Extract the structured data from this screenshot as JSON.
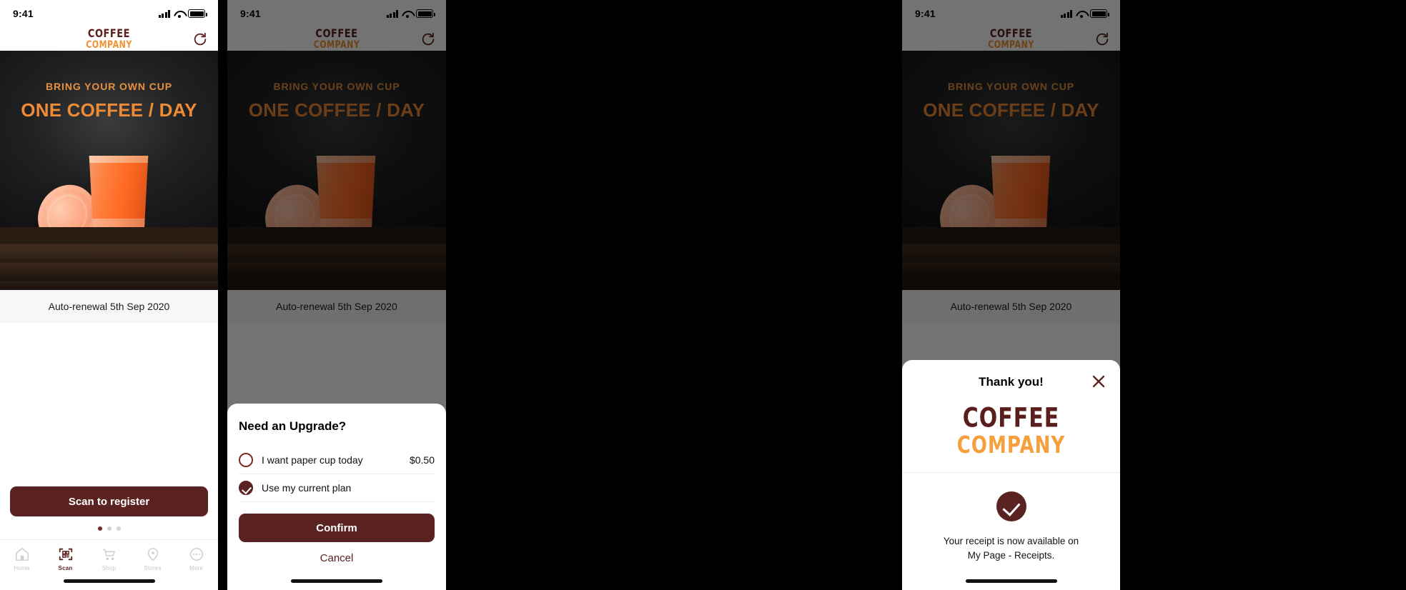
{
  "status_bar": {
    "time": "9:41"
  },
  "brand": {
    "logo_line1": "COFFEE",
    "logo_line2": "COMPANY",
    "primary_color": "#5a2220",
    "accent_color": "#f09433"
  },
  "header": {
    "refresh_icon": "refresh-icon"
  },
  "hero": {
    "kicker": "BRING YOUR OWN CUP",
    "headline": "ONE COFFEE / DAY"
  },
  "panel1": {
    "renewal_text": "Auto-renewal 5th Sep 2020",
    "cta_label": "Scan to register",
    "carousel": {
      "total": 3,
      "active_index": 0
    },
    "tabs": [
      {
        "label": "Home",
        "icon": "home-icon",
        "active": false
      },
      {
        "label": "Scan",
        "icon": "qr-scan-icon",
        "active": true
      },
      {
        "label": "Shop",
        "icon": "cart-icon",
        "active": false
      },
      {
        "label": "Stores",
        "icon": "pin-icon",
        "active": false
      },
      {
        "label": "More",
        "icon": "ellipsis-icon",
        "active": false
      }
    ]
  },
  "panel2": {
    "sheet_title": "Need an Upgrade?",
    "options": [
      {
        "label": "I want paper cup today",
        "price": "$0.50",
        "selected": false
      },
      {
        "label": "Use my current plan",
        "price": "",
        "selected": true
      }
    ],
    "confirm_label": "Confirm",
    "cancel_label": "Cancel"
  },
  "panel4": {
    "sheet_title": "Thank you!",
    "close_icon": "close-icon",
    "success_icon": "check-circle-icon",
    "message_line1": "Your receipt is now available on",
    "message_line2": "My Page - Receipts."
  }
}
